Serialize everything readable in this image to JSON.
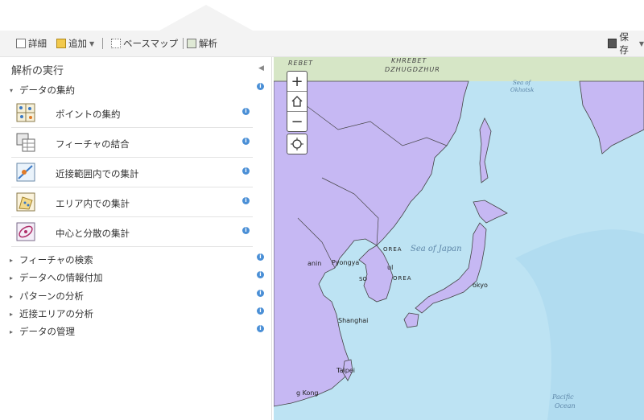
{
  "toolbar": {
    "details": "詳細",
    "add": "追加",
    "basemap": "ベースマップ",
    "analysis": "解析",
    "save": "保存"
  },
  "panel": {
    "title": "解析の実行",
    "expanded_section": "データの集約",
    "tools": [
      {
        "label": "ポイントの集約",
        "icon": "aggregate-points-icon"
      },
      {
        "label": "フィーチャの結合",
        "icon": "join-features-icon"
      },
      {
        "label": "近接範囲内での集計",
        "icon": "summarize-nearby-icon"
      },
      {
        "label": "エリア内での集計",
        "icon": "summarize-within-icon"
      },
      {
        "label": "中心と分散の集計",
        "icon": "summarize-center-dispersion-icon"
      }
    ],
    "sections": [
      "フィーチャの検索",
      "データへの情報付加",
      "パターンの分析",
      "近接エリアの分析",
      "データの管理"
    ]
  },
  "map": {
    "labels": {
      "khrebet": "KHREBET",
      "dzhugdzhur": "DZHUGDZHUR",
      "khrebet_partial": "REBET",
      "sea_okhotsk_1": "Sea of",
      "sea_okhotsk_2": "Okhotsk",
      "sea_japan": "Sea of Japan",
      "pyongyang": "Pyongya",
      "dalian": "anin",
      "korea_n": "OREA",
      "seoul": "ul",
      "korea_s": "OREA",
      "so": "SO",
      "tokyo": "okyo",
      "shanghai": "Shanghai",
      "taipei": "Taipei",
      "hongkong": "g Kong",
      "pacific_1": "Pacific",
      "pacific_2": "Ocean"
    },
    "colors": {
      "overlay": "#c6b8f3",
      "water": "#bde3f3",
      "border": "#444444"
    }
  }
}
